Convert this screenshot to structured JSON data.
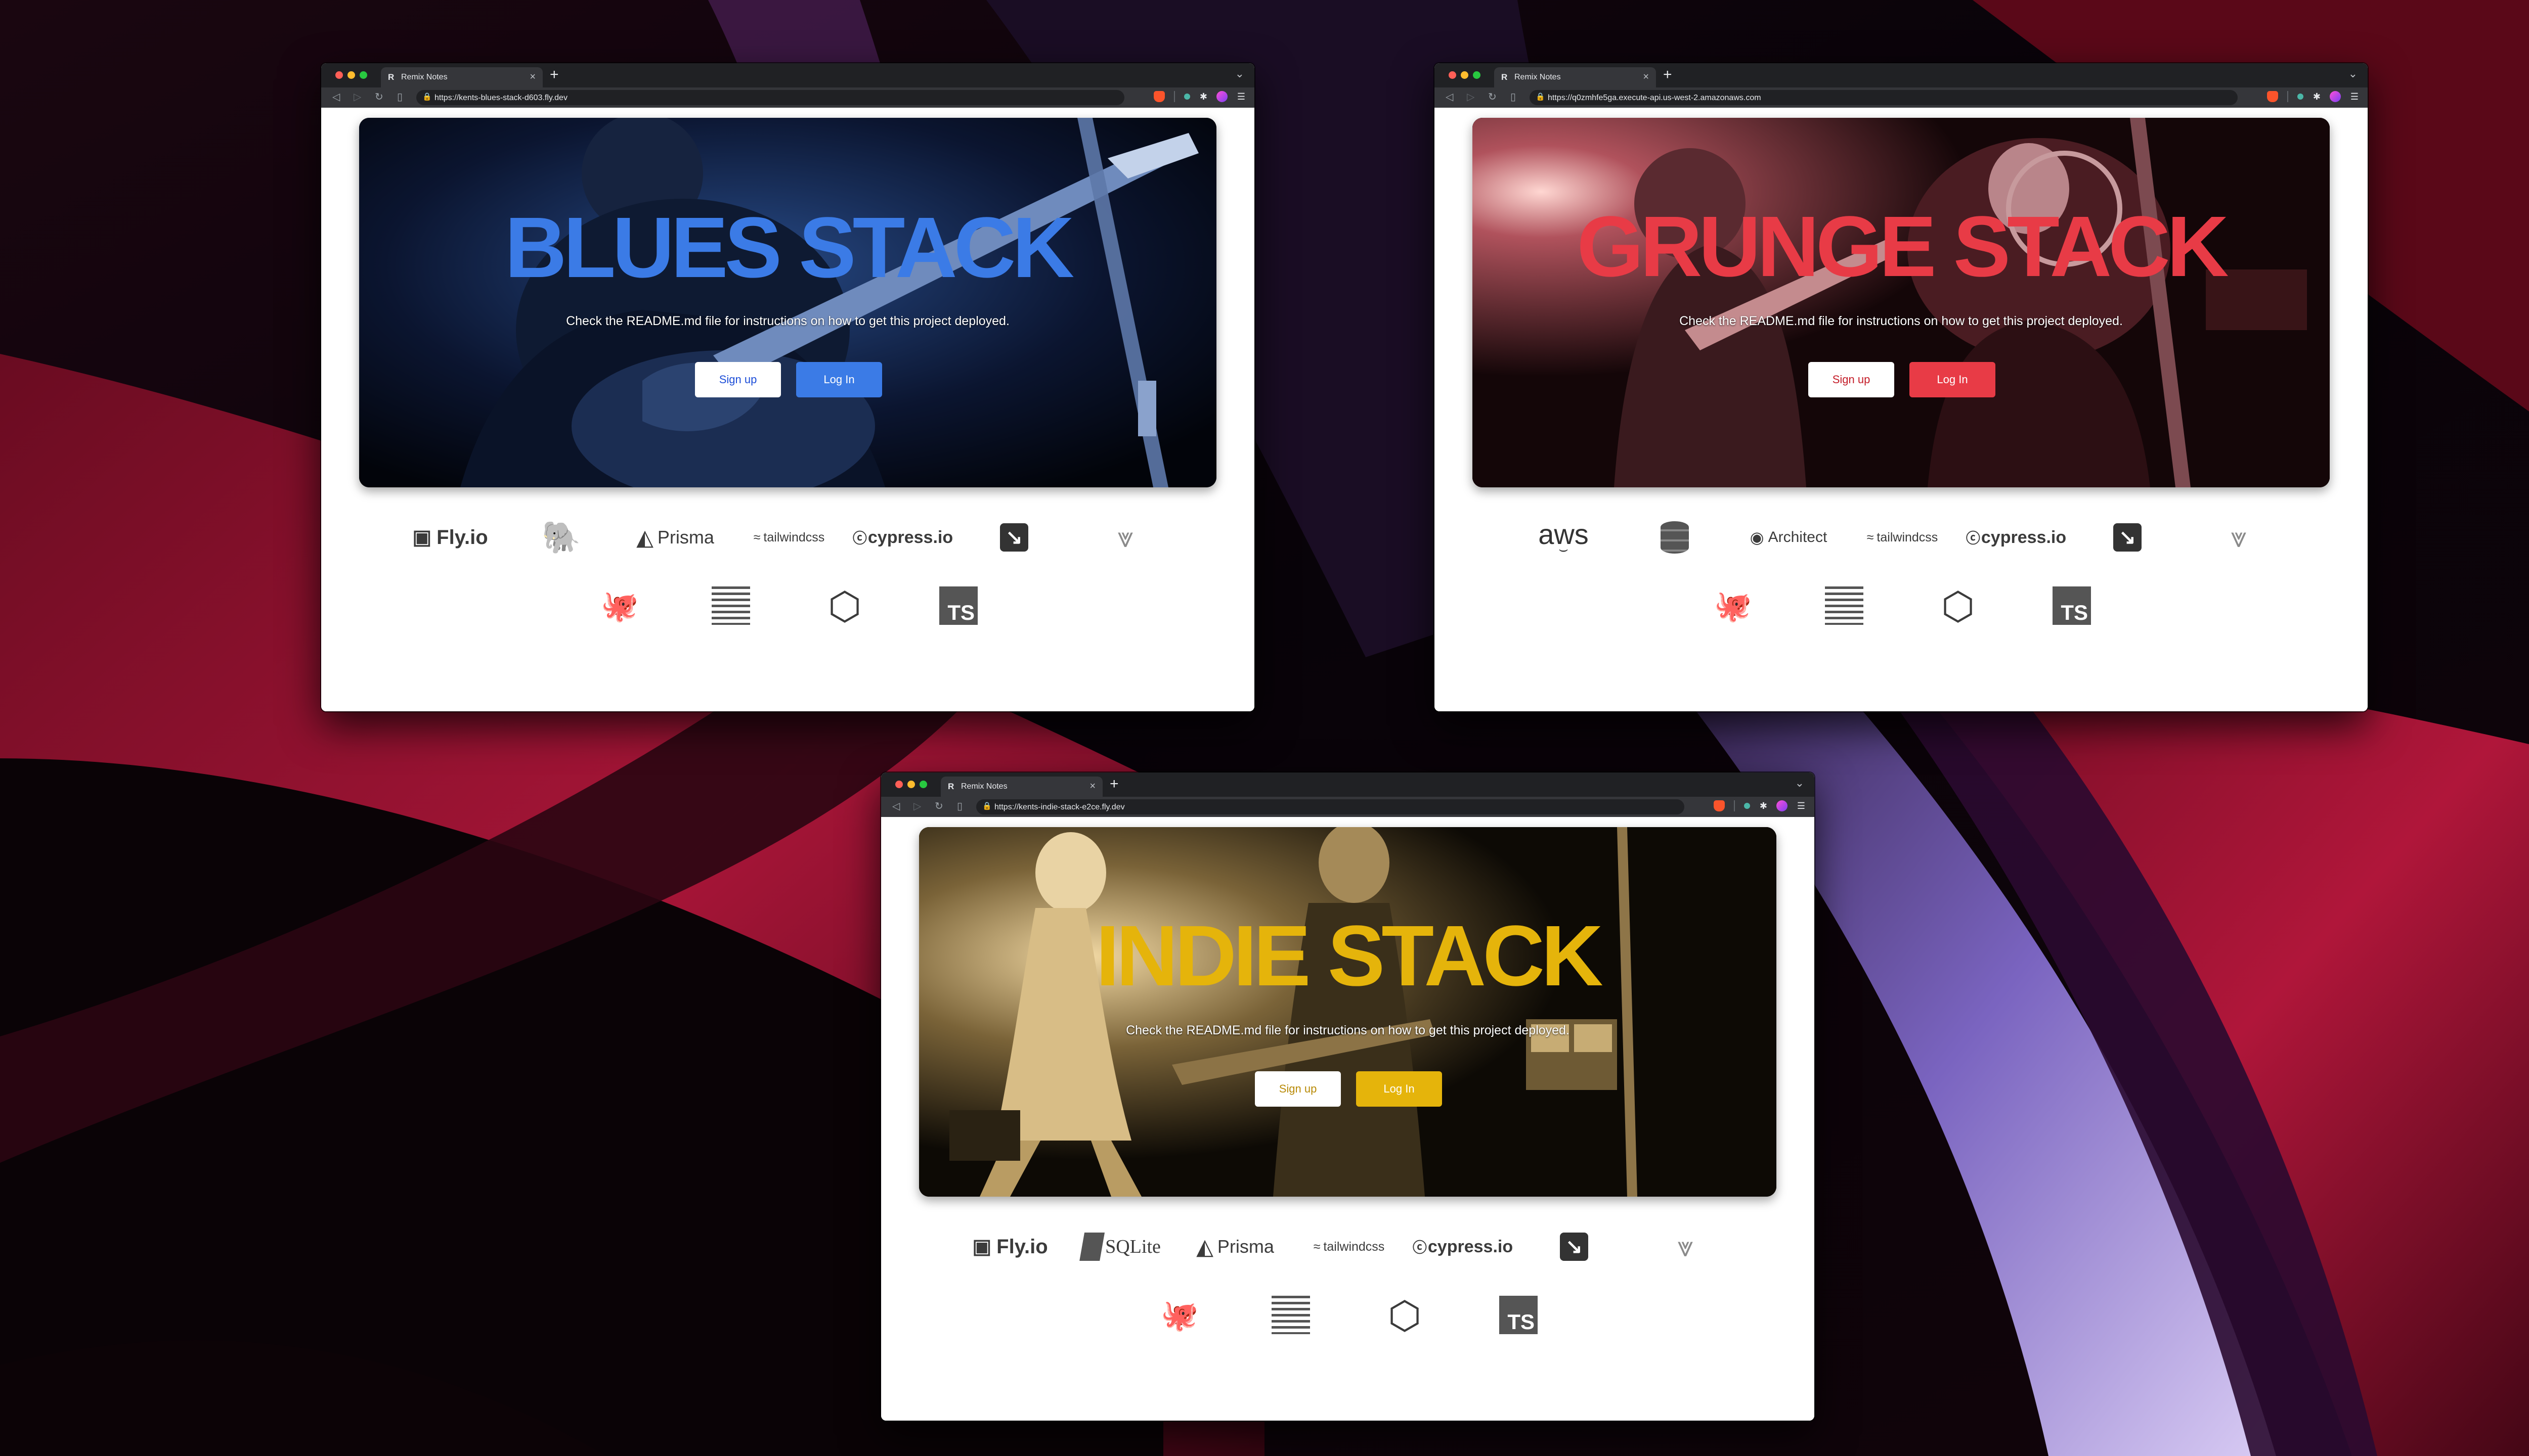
{
  "windows": [
    {
      "tab_title": "Remix Notes",
      "url": "https://kents-blues-stack-d603.fly.dev",
      "stack_title": "BLUES STACK",
      "accent": "#3b7be6",
      "subtitle": "Check the README.md file for instructions on how to get this project deployed.",
      "signup_label": "Sign up",
      "login_label": "Log In",
      "logos_row1": [
        {
          "icon": "fly-balloon-icon",
          "text": "Fly.io"
        },
        {
          "icon": "postgres-elephant-icon",
          "text": ""
        },
        {
          "icon": "prisma-triangle-icon",
          "text": "Prisma"
        },
        {
          "icon": "tailwind-wave-icon",
          "text": "tailwindcss"
        },
        {
          "icon": "cypress-icon",
          "text": "cypress.io"
        },
        {
          "icon": "msw-icon",
          "text": ""
        },
        {
          "icon": "vitest-icon",
          "text": ""
        }
      ],
      "logos_row2": [
        {
          "icon": "testing-library-octopus-icon",
          "text": ""
        },
        {
          "icon": "prettier-icon",
          "text": ""
        },
        {
          "icon": "eslint-hexagon-icon",
          "text": ""
        },
        {
          "icon": "typescript-icon",
          "text": "TS"
        }
      ]
    },
    {
      "tab_title": "Remix Notes",
      "url": "https://q0zmhfe5ga.execute-api.us-west-2.amazonaws.com",
      "stack_title": "GRUNGE STACK",
      "accent": "#e83b46",
      "subtitle": "Check the README.md file for instructions on how to get this project deployed.",
      "signup_label": "Sign up",
      "login_label": "Log In",
      "logos_row1": [
        {
          "icon": "aws-icon",
          "text": "aws"
        },
        {
          "icon": "dynamodb-icon",
          "text": ""
        },
        {
          "icon": "architect-icon",
          "text": "Architect"
        },
        {
          "icon": "tailwind-wave-icon",
          "text": "tailwindcss"
        },
        {
          "icon": "cypress-icon",
          "text": "cypress.io"
        },
        {
          "icon": "msw-icon",
          "text": ""
        },
        {
          "icon": "vitest-icon",
          "text": ""
        }
      ],
      "logos_row2": [
        {
          "icon": "testing-library-octopus-icon",
          "text": ""
        },
        {
          "icon": "prettier-icon",
          "text": ""
        },
        {
          "icon": "eslint-hexagon-icon",
          "text": ""
        },
        {
          "icon": "typescript-icon",
          "text": "TS"
        }
      ]
    },
    {
      "tab_title": "Remix Notes",
      "url": "https://kents-indie-stack-e2ce.fly.dev",
      "stack_title": "INDIE STACK",
      "accent": "#e5b40b",
      "subtitle": "Check the README.md file for instructions on how to get this project deployed.",
      "signup_label": "Sign up",
      "login_label": "Log In",
      "logos_row1": [
        {
          "icon": "fly-balloon-icon",
          "text": "Fly.io"
        },
        {
          "icon": "sqlite-icon",
          "text": "SQLite"
        },
        {
          "icon": "prisma-triangle-icon",
          "text": "Prisma"
        },
        {
          "icon": "tailwind-wave-icon",
          "text": "tailwindcss"
        },
        {
          "icon": "cypress-icon",
          "text": "cypress.io"
        },
        {
          "icon": "msw-icon",
          "text": ""
        },
        {
          "icon": "vitest-icon",
          "text": ""
        }
      ],
      "logos_row2": [
        {
          "icon": "testing-library-octopus-icon",
          "text": ""
        },
        {
          "icon": "prettier-icon",
          "text": ""
        },
        {
          "icon": "eslint-hexagon-icon",
          "text": ""
        },
        {
          "icon": "typescript-icon",
          "text": "TS"
        }
      ]
    }
  ]
}
